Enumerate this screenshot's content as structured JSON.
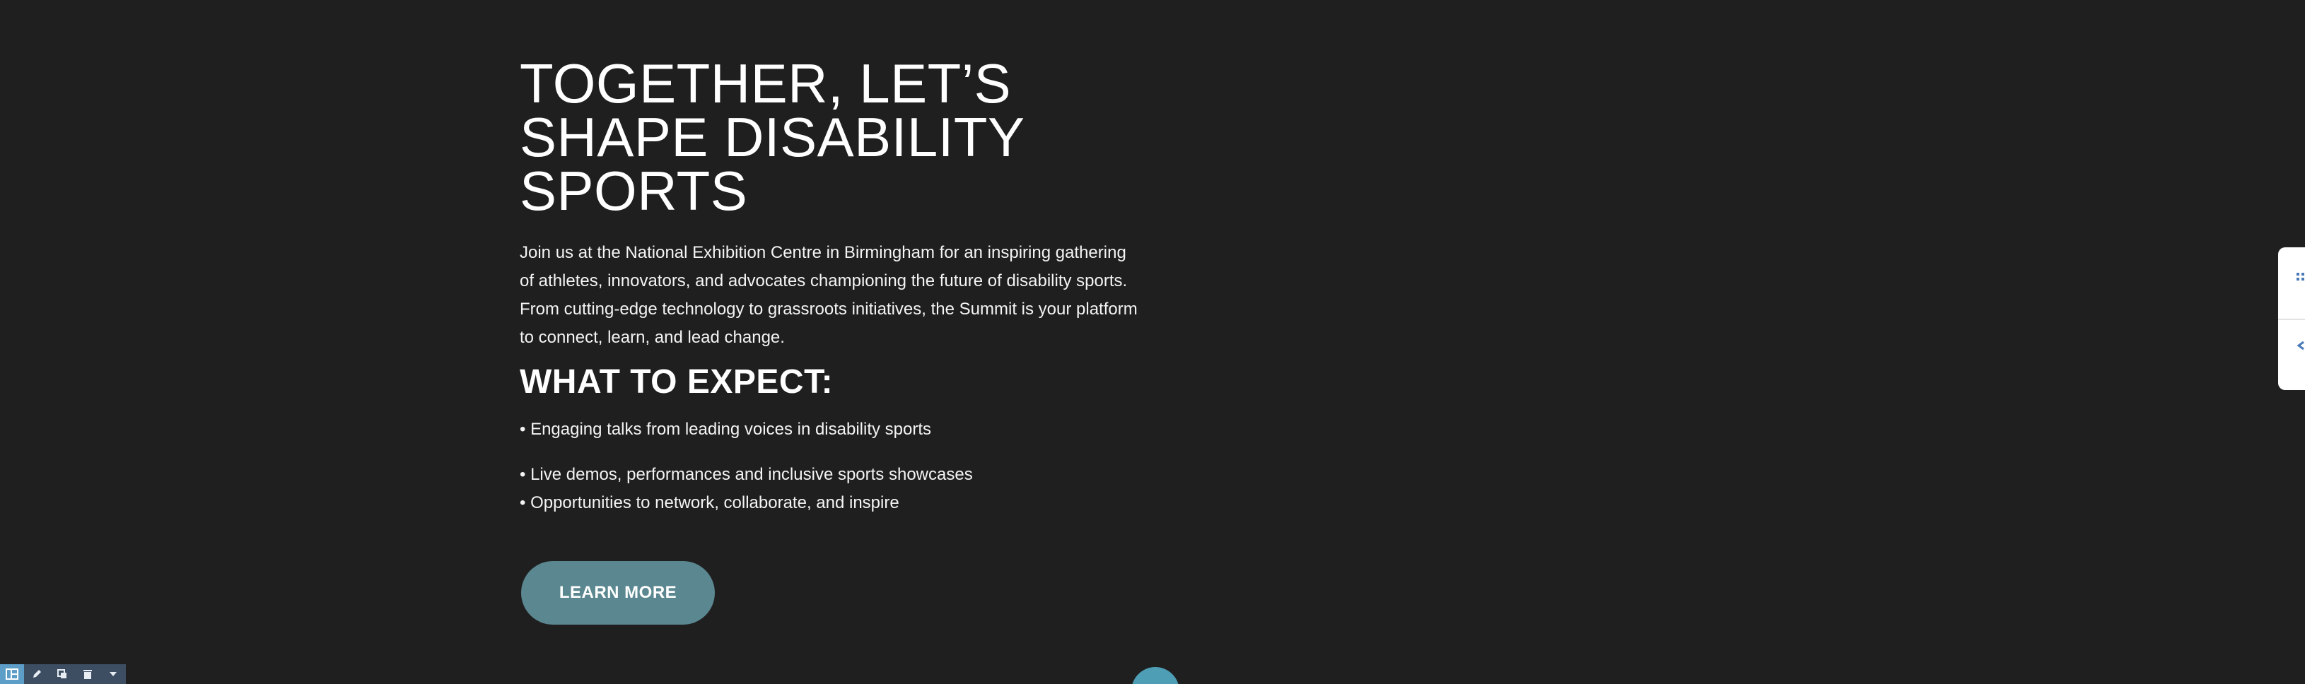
{
  "hero": {
    "title_lines": [
      "TOGETHER, LET’S",
      "SHAPE DISABILITY",
      "SPORTS"
    ],
    "intro": "Join us at the National Exhibition Centre in Birmingham for an inspiring gathering of athletes, innovators, and advocates championing the future of disability sports. From cutting-edge technology to grassroots initiatives, the Summit is your platform to connect, learn, and lead change."
  },
  "expect": {
    "title": "WHAT TO EXPECT:",
    "items": [
      "• Engaging talks from leading voices in disability sports",
      "• Live demos, performances and inclusive sports showcases",
      "• Opportunities to network, collaborate, and inspire"
    ]
  },
  "cta": {
    "label": "LEARN MORE"
  },
  "side_panel": {
    "icons": [
      "grid-icon",
      "arrow-left-icon"
    ]
  },
  "toolbar": {
    "icons": [
      "layout-icon",
      "pencil-icon",
      "duplicate-icon",
      "trash-icon",
      "caret-down-icon"
    ]
  },
  "colors": {
    "background": "#1f1f1f",
    "button": "#5a8790",
    "toolbar": "#3d4e62",
    "toolbar_active": "#5d9ec9",
    "handle": "#4e9fb6"
  }
}
